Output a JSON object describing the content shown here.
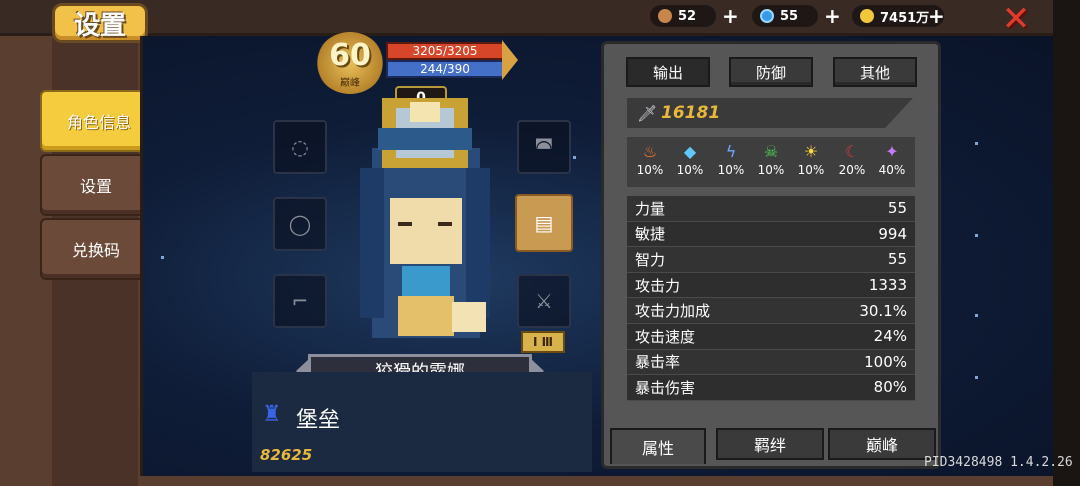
{
  "header": {
    "title": "设置",
    "resources": [
      {
        "icon": "boot-icon",
        "value": "52"
      },
      {
        "icon": "gem-icon",
        "value": "55"
      },
      {
        "icon": "coin-icon",
        "value": "7451万"
      }
    ],
    "plus": "+",
    "close": "✕"
  },
  "sidebar": {
    "items": [
      {
        "label": "角色信息",
        "active": true
      },
      {
        "label": "设置",
        "active": false
      },
      {
        "label": "兑换码",
        "active": false
      }
    ]
  },
  "hero": {
    "level": "60",
    "level_sub": "巅峰",
    "hp": "3205/3205",
    "mp": "244/390",
    "counter": "0",
    "name": "狡猾的露娜",
    "tier": "Ⅰ Ⅲ",
    "class_name": "堡垒",
    "power": "82625"
  },
  "stats": {
    "tabs": [
      {
        "label": "输出",
        "active": true
      },
      {
        "label": "防御",
        "active": false
      },
      {
        "label": "其他",
        "active": false
      }
    ],
    "attack": "16181",
    "elements": [
      {
        "icon": "fire-icon",
        "value": "10%",
        "color": "#ff7a2a"
      },
      {
        "icon": "ice-icon",
        "value": "10%",
        "color": "#5ec8ff"
      },
      {
        "icon": "lightning-icon",
        "value": "10%",
        "color": "#6aa8ff"
      },
      {
        "icon": "poison-icon",
        "value": "10%",
        "color": "#4ccc5a"
      },
      {
        "icon": "light-icon",
        "value": "10%",
        "color": "#ffd83a"
      },
      {
        "icon": "dark-icon",
        "value": "20%",
        "color": "#d83a3a"
      },
      {
        "icon": "arcane-icon",
        "value": "40%",
        "color": "#c87aff"
      }
    ],
    "attributes": [
      {
        "name": "力量",
        "value": "55"
      },
      {
        "name": "敏捷",
        "value": "994"
      },
      {
        "name": "智力",
        "value": "55"
      },
      {
        "name": "攻击力",
        "value": "1333"
      },
      {
        "name": "攻击力加成",
        "value": "30.1%"
      },
      {
        "name": "攻击速度",
        "value": "24%"
      },
      {
        "name": "暴击率",
        "value": "100%"
      },
      {
        "name": "暴击伤害",
        "value": "80%"
      }
    ],
    "bottom_tabs": [
      {
        "label": "属性",
        "active": true
      },
      {
        "label": "羁绊",
        "active": false
      },
      {
        "label": "巅峰",
        "active": false
      }
    ]
  },
  "footer": {
    "pid": "PID3428498 1.4.2.26"
  }
}
